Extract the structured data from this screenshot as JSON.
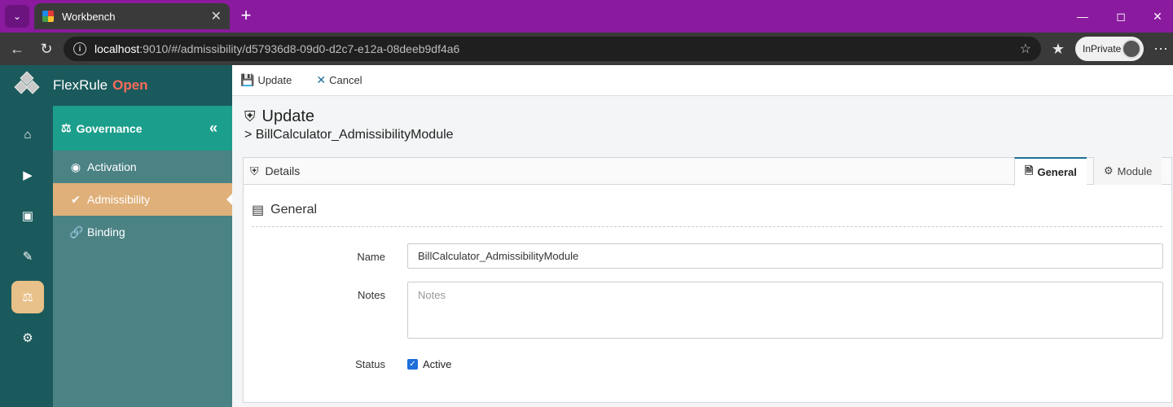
{
  "browser": {
    "tab_title": "Workbench",
    "new_tab_icon": "plus-icon",
    "url_host": "localhost",
    "url_rest": ":9010/#/admissibility/d57936d8-09d0-d2c7-e12a-08deeb9df4a6",
    "inprivate_label": "InPrivate"
  },
  "app": {
    "brand_name": "FlexRule",
    "brand_suffix": "Open"
  },
  "rail": [
    "home-icon",
    "play-icon",
    "archive-icon",
    "pencil-icon",
    "balance-scale-icon",
    "gear-icon"
  ],
  "subnav": {
    "header": "Governance",
    "items": [
      {
        "label": "Activation",
        "icon": "toggle-icon"
      },
      {
        "label": "Admissibility",
        "icon": "check-circle-icon"
      },
      {
        "label": "Binding",
        "icon": "link-icon"
      }
    ]
  },
  "toolbar": {
    "update_label": "Update",
    "cancel_label": "Cancel"
  },
  "page": {
    "title": "Update",
    "subtitle": "> BillCalculator_AdmissibilityModule"
  },
  "panel": {
    "header": "Details",
    "tabs": [
      "General",
      "Module"
    ],
    "active_tab": "General",
    "section_title": "General"
  },
  "form": {
    "name_label": "Name",
    "name_value": "BillCalculator_AdmissibilityModule",
    "notes_label": "Notes",
    "notes_placeholder": "Notes",
    "status_label": "Status",
    "status_check_label": "Active",
    "status_checked": true
  },
  "colors": {
    "tabbar": "#8a1a9e",
    "rail": "#1b5a5c",
    "subnav": "#4b8284",
    "subnav_header": "#1c9e8c",
    "active_item": "#e0b07a",
    "brand_accent": "#ff6b5a"
  }
}
